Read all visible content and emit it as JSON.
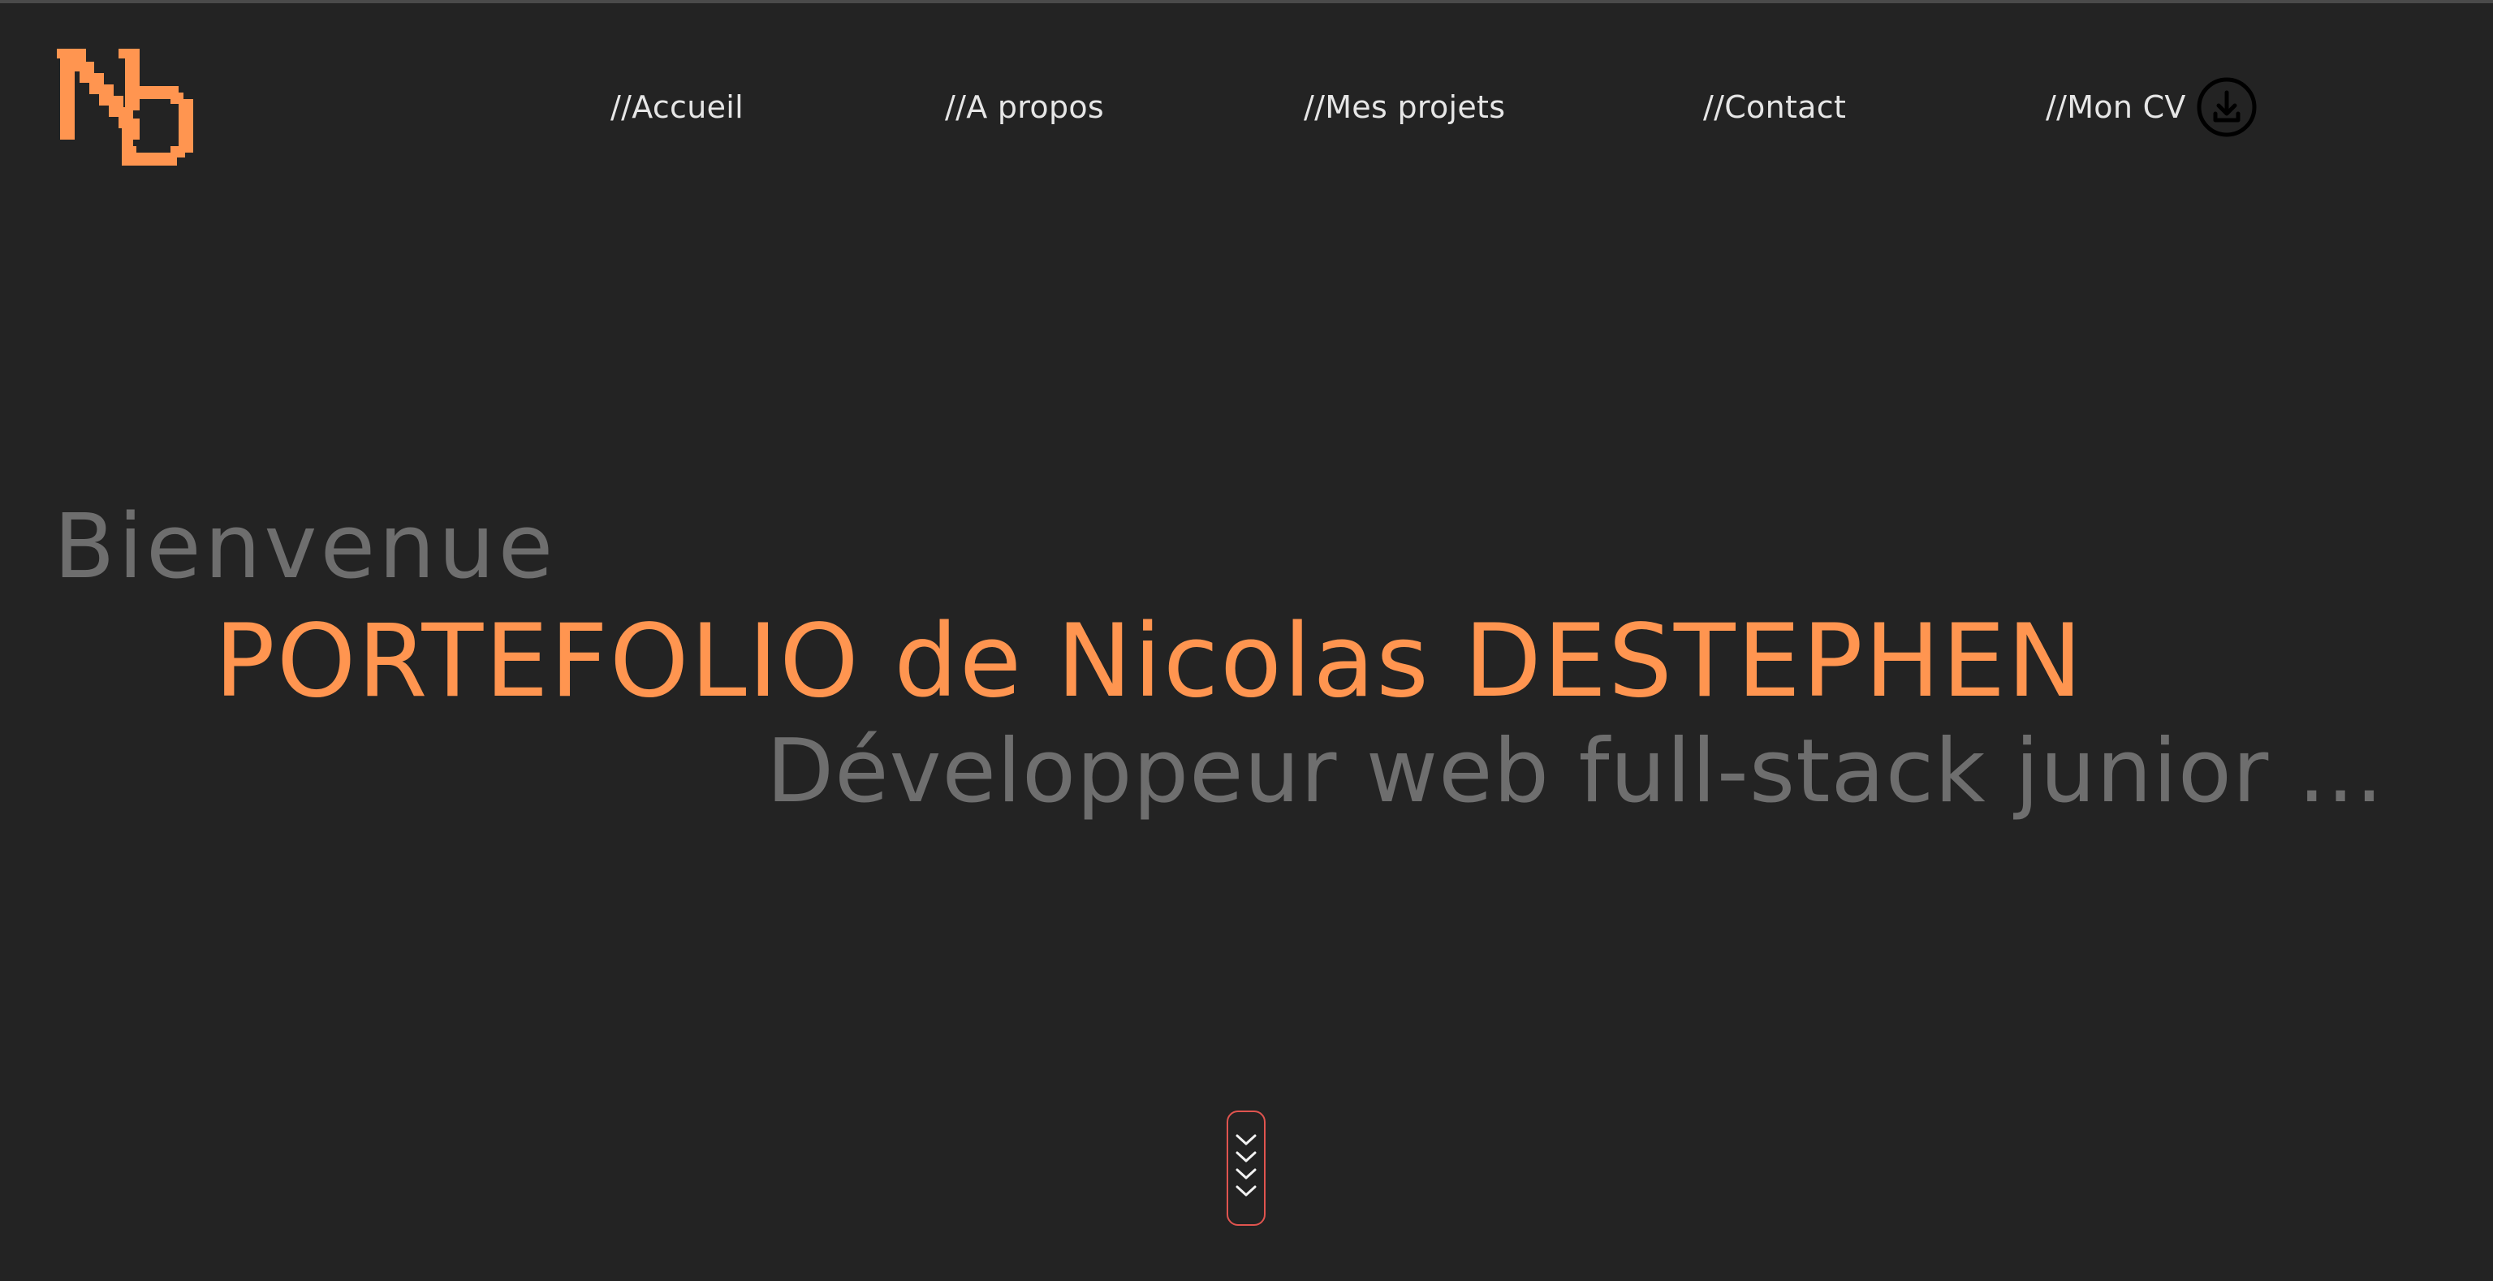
{
  "logo": {
    "icon": "nd-pixel-logo-icon",
    "color": "#ff9550"
  },
  "nav": {
    "items": [
      {
        "label": "//Accueil"
      },
      {
        "label": "//A propos"
      },
      {
        "label": "//Mes projets"
      },
      {
        "label": "//Contact"
      },
      {
        "label": "//Mon CV"
      }
    ],
    "cv_icon": "download-icon"
  },
  "hero": {
    "welcome": "Bienvenue",
    "title": "PORTEFOLIO de Nicolas DESTEPHEN",
    "subtitle": "Développeur web full-stack junior ..."
  },
  "scroll": {
    "icon": "chevrons-down-icon",
    "border_color": "#e0544f"
  },
  "colors": {
    "background": "#232323",
    "accent": "#ff9550",
    "muted_text": "#6e6e6e",
    "nav_text": "#e6e6e6"
  }
}
